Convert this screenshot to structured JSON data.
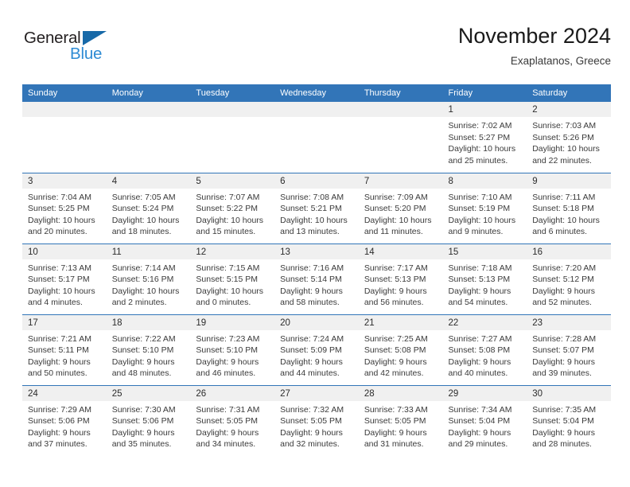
{
  "brand": {
    "word_one": "General",
    "word_two": "Blue",
    "triangle_icon": "triangle-icon",
    "accent_dark": "#1769a8",
    "accent_light": "#2e8bd4"
  },
  "header": {
    "title": "November 2024",
    "subtitle": "Exaplatanos, Greece"
  },
  "theme": {
    "header_blue": "#3275b8",
    "daynum_band": "#f0f0f0"
  },
  "calendar": {
    "weekday_headers": [
      "Sunday",
      "Monday",
      "Tuesday",
      "Wednesday",
      "Thursday",
      "Friday",
      "Saturday"
    ],
    "weeks": [
      [
        {
          "empty": true
        },
        {
          "empty": true
        },
        {
          "empty": true
        },
        {
          "empty": true
        },
        {
          "empty": true
        },
        {
          "day": "1",
          "sunrise": "Sunrise: 7:02 AM",
          "sunset": "Sunset: 5:27 PM",
          "daylight_line1": "Daylight: 10 hours",
          "daylight_line2": "and 25 minutes."
        },
        {
          "day": "2",
          "sunrise": "Sunrise: 7:03 AM",
          "sunset": "Sunset: 5:26 PM",
          "daylight_line1": "Daylight: 10 hours",
          "daylight_line2": "and 22 minutes."
        }
      ],
      [
        {
          "day": "3",
          "sunrise": "Sunrise: 7:04 AM",
          "sunset": "Sunset: 5:25 PM",
          "daylight_line1": "Daylight: 10 hours",
          "daylight_line2": "and 20 minutes."
        },
        {
          "day": "4",
          "sunrise": "Sunrise: 7:05 AM",
          "sunset": "Sunset: 5:24 PM",
          "daylight_line1": "Daylight: 10 hours",
          "daylight_line2": "and 18 minutes."
        },
        {
          "day": "5",
          "sunrise": "Sunrise: 7:07 AM",
          "sunset": "Sunset: 5:22 PM",
          "daylight_line1": "Daylight: 10 hours",
          "daylight_line2": "and 15 minutes."
        },
        {
          "day": "6",
          "sunrise": "Sunrise: 7:08 AM",
          "sunset": "Sunset: 5:21 PM",
          "daylight_line1": "Daylight: 10 hours",
          "daylight_line2": "and 13 minutes."
        },
        {
          "day": "7",
          "sunrise": "Sunrise: 7:09 AM",
          "sunset": "Sunset: 5:20 PM",
          "daylight_line1": "Daylight: 10 hours",
          "daylight_line2": "and 11 minutes."
        },
        {
          "day": "8",
          "sunrise": "Sunrise: 7:10 AM",
          "sunset": "Sunset: 5:19 PM",
          "daylight_line1": "Daylight: 10 hours",
          "daylight_line2": "and 9 minutes."
        },
        {
          "day": "9",
          "sunrise": "Sunrise: 7:11 AM",
          "sunset": "Sunset: 5:18 PM",
          "daylight_line1": "Daylight: 10 hours",
          "daylight_line2": "and 6 minutes."
        }
      ],
      [
        {
          "day": "10",
          "sunrise": "Sunrise: 7:13 AM",
          "sunset": "Sunset: 5:17 PM",
          "daylight_line1": "Daylight: 10 hours",
          "daylight_line2": "and 4 minutes."
        },
        {
          "day": "11",
          "sunrise": "Sunrise: 7:14 AM",
          "sunset": "Sunset: 5:16 PM",
          "daylight_line1": "Daylight: 10 hours",
          "daylight_line2": "and 2 minutes."
        },
        {
          "day": "12",
          "sunrise": "Sunrise: 7:15 AM",
          "sunset": "Sunset: 5:15 PM",
          "daylight_line1": "Daylight: 10 hours",
          "daylight_line2": "and 0 minutes."
        },
        {
          "day": "13",
          "sunrise": "Sunrise: 7:16 AM",
          "sunset": "Sunset: 5:14 PM",
          "daylight_line1": "Daylight: 9 hours",
          "daylight_line2": "and 58 minutes."
        },
        {
          "day": "14",
          "sunrise": "Sunrise: 7:17 AM",
          "sunset": "Sunset: 5:13 PM",
          "daylight_line1": "Daylight: 9 hours",
          "daylight_line2": "and 56 minutes."
        },
        {
          "day": "15",
          "sunrise": "Sunrise: 7:18 AM",
          "sunset": "Sunset: 5:13 PM",
          "daylight_line1": "Daylight: 9 hours",
          "daylight_line2": "and 54 minutes."
        },
        {
          "day": "16",
          "sunrise": "Sunrise: 7:20 AM",
          "sunset": "Sunset: 5:12 PM",
          "daylight_line1": "Daylight: 9 hours",
          "daylight_line2": "and 52 minutes."
        }
      ],
      [
        {
          "day": "17",
          "sunrise": "Sunrise: 7:21 AM",
          "sunset": "Sunset: 5:11 PM",
          "daylight_line1": "Daylight: 9 hours",
          "daylight_line2": "and 50 minutes."
        },
        {
          "day": "18",
          "sunrise": "Sunrise: 7:22 AM",
          "sunset": "Sunset: 5:10 PM",
          "daylight_line1": "Daylight: 9 hours",
          "daylight_line2": "and 48 minutes."
        },
        {
          "day": "19",
          "sunrise": "Sunrise: 7:23 AM",
          "sunset": "Sunset: 5:10 PM",
          "daylight_line1": "Daylight: 9 hours",
          "daylight_line2": "and 46 minutes."
        },
        {
          "day": "20",
          "sunrise": "Sunrise: 7:24 AM",
          "sunset": "Sunset: 5:09 PM",
          "daylight_line1": "Daylight: 9 hours",
          "daylight_line2": "and 44 minutes."
        },
        {
          "day": "21",
          "sunrise": "Sunrise: 7:25 AM",
          "sunset": "Sunset: 5:08 PM",
          "daylight_line1": "Daylight: 9 hours",
          "daylight_line2": "and 42 minutes."
        },
        {
          "day": "22",
          "sunrise": "Sunrise: 7:27 AM",
          "sunset": "Sunset: 5:08 PM",
          "daylight_line1": "Daylight: 9 hours",
          "daylight_line2": "and 40 minutes."
        },
        {
          "day": "23",
          "sunrise": "Sunrise: 7:28 AM",
          "sunset": "Sunset: 5:07 PM",
          "daylight_line1": "Daylight: 9 hours",
          "daylight_line2": "and 39 minutes."
        }
      ],
      [
        {
          "day": "24",
          "sunrise": "Sunrise: 7:29 AM",
          "sunset": "Sunset: 5:06 PM",
          "daylight_line1": "Daylight: 9 hours",
          "daylight_line2": "and 37 minutes."
        },
        {
          "day": "25",
          "sunrise": "Sunrise: 7:30 AM",
          "sunset": "Sunset: 5:06 PM",
          "daylight_line1": "Daylight: 9 hours",
          "daylight_line2": "and 35 minutes."
        },
        {
          "day": "26",
          "sunrise": "Sunrise: 7:31 AM",
          "sunset": "Sunset: 5:05 PM",
          "daylight_line1": "Daylight: 9 hours",
          "daylight_line2": "and 34 minutes."
        },
        {
          "day": "27",
          "sunrise": "Sunrise: 7:32 AM",
          "sunset": "Sunset: 5:05 PM",
          "daylight_line1": "Daylight: 9 hours",
          "daylight_line2": "and 32 minutes."
        },
        {
          "day": "28",
          "sunrise": "Sunrise: 7:33 AM",
          "sunset": "Sunset: 5:05 PM",
          "daylight_line1": "Daylight: 9 hours",
          "daylight_line2": "and 31 minutes."
        },
        {
          "day": "29",
          "sunrise": "Sunrise: 7:34 AM",
          "sunset": "Sunset: 5:04 PM",
          "daylight_line1": "Daylight: 9 hours",
          "daylight_line2": "and 29 minutes."
        },
        {
          "day": "30",
          "sunrise": "Sunrise: 7:35 AM",
          "sunset": "Sunset: 5:04 PM",
          "daylight_line1": "Daylight: 9 hours",
          "daylight_line2": "and 28 minutes."
        }
      ]
    ]
  }
}
